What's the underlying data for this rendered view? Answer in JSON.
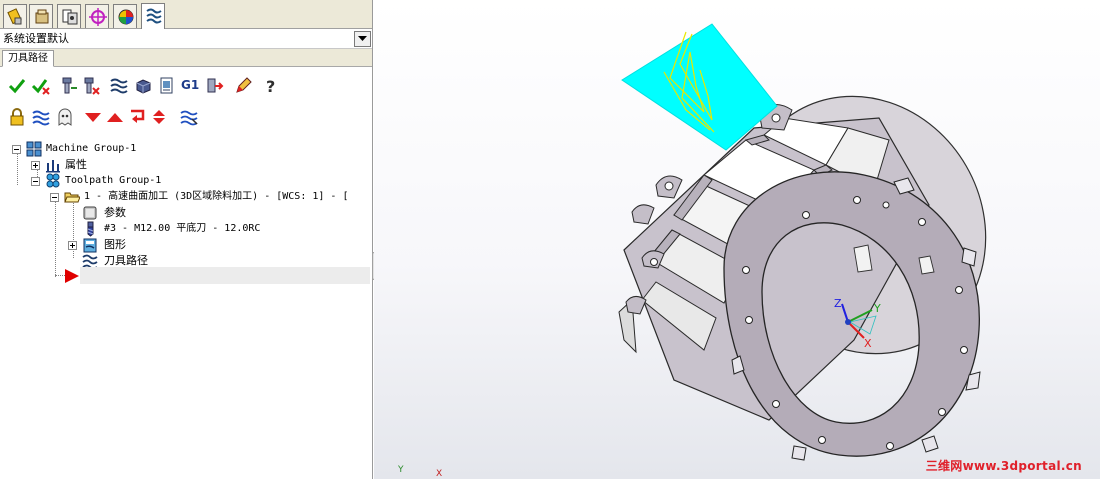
{
  "left_panel": {
    "config_label": "系统设置默认",
    "subtab_label": "刀具路径",
    "tree": {
      "machine_group": "Machine Group-1",
      "properties": "属性",
      "toolpath_group": "Toolpath Group-1",
      "operation": "1 - 高速曲面加工 (3D区域除料加工) - [WCS: 1] - [",
      "parameters": "参数",
      "tool": "#3 - M12.00 平底刀 - 12.0RC",
      "geometry": "图形",
      "toolpath": "刀具路径"
    },
    "toolbar_g1": "G1"
  },
  "viewport": {
    "axis_z": "Z",
    "axis_y": "Y",
    "axis_x": "X",
    "corner_y": "Y",
    "corner_x": "X",
    "watermark": "三维网www.3dportal.cn"
  },
  "colors": {
    "part_face": "#b4acb8",
    "part_inner": "#ffffff",
    "toolpath_cyan": "#00ffff",
    "toolpath_yellow": "#e8e800",
    "axis_x": "#e02020",
    "axis_y": "#20a020",
    "axis_z": "#2020e0"
  }
}
